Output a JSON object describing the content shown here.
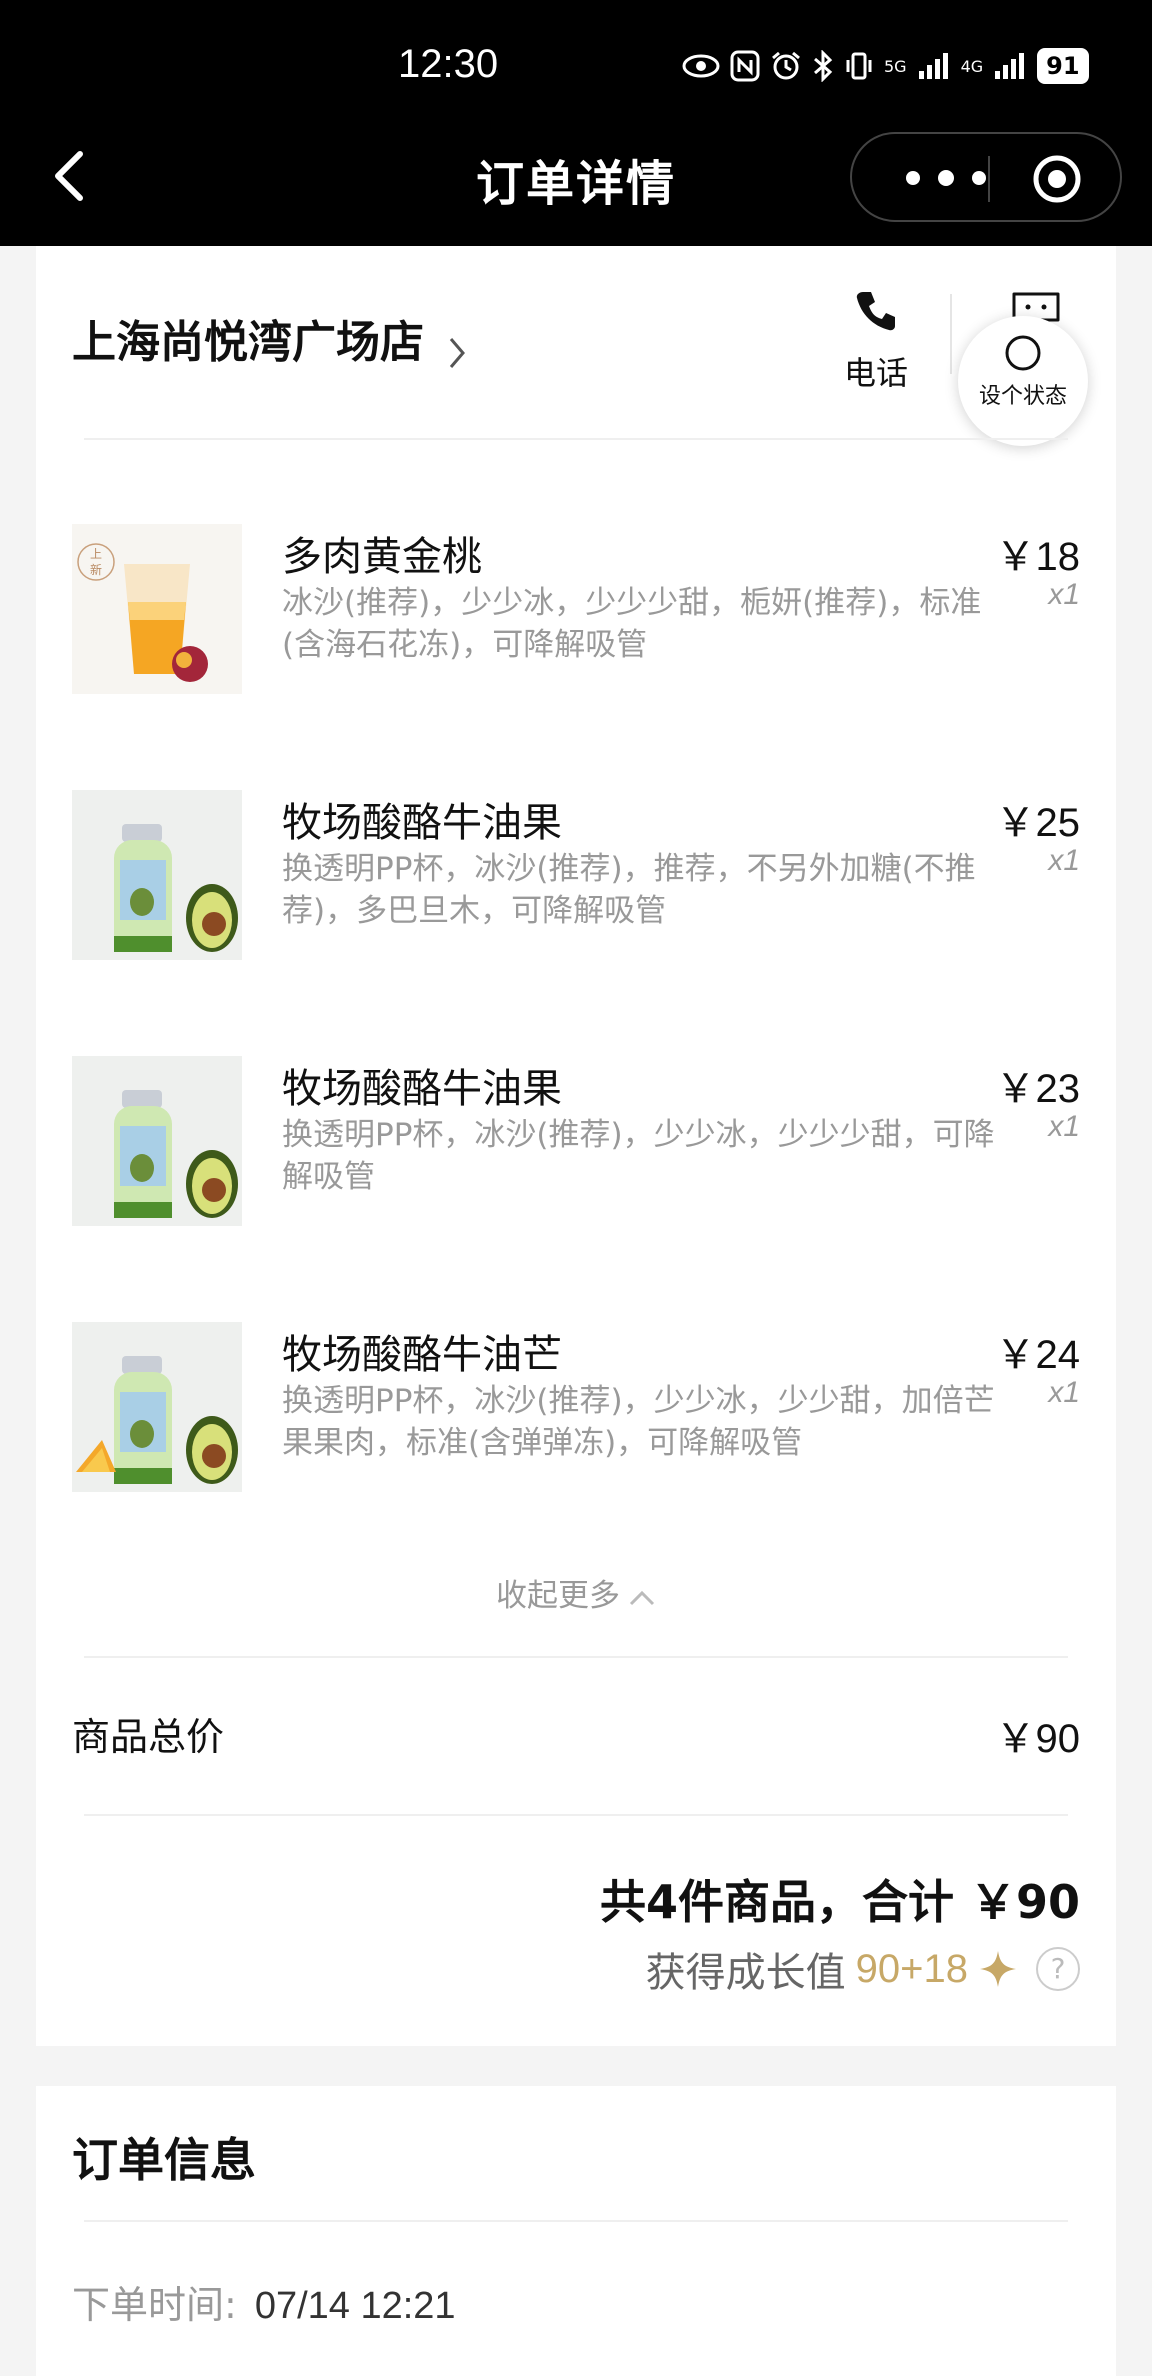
{
  "status_bar": {
    "time": "12:30",
    "network_5g": "5G",
    "network_4g": "4G",
    "battery": "91"
  },
  "nav": {
    "title": "订单详情",
    "back_icon": "chevron-left-icon",
    "more_icon": "more-dots-icon",
    "close_icon": "target-circle-icon"
  },
  "store": {
    "name": "上海尚悦湾广场店",
    "phone_label": "电话",
    "float_status_label": "设个状态"
  },
  "items": [
    {
      "name": "多肉黄金桃",
      "desc": "冰沙(推荐)，少少冰，少少少甜，栀妍(推荐)，标准(含海石花冻)，可降解吸管",
      "price": "￥18",
      "qty": "x1",
      "badge_top": "上",
      "badge_bottom": "新",
      "thumb": "peach-drink"
    },
    {
      "name": "牧场酸酪牛油果",
      "desc": "换透明PP杯，冰沙(推荐)，推荐，不另外加糖(不推荐)，多巴旦木，可降解吸管",
      "price": "￥25",
      "qty": "x1",
      "thumb": "avocado-bottle"
    },
    {
      "name": "牧场酸酪牛油果",
      "desc": "换透明PP杯，冰沙(推荐)，少少冰，少少少甜，可降解吸管",
      "price": "￥23",
      "qty": "x1",
      "thumb": "avocado-bottle"
    },
    {
      "name": "牧场酸酪牛油芒",
      "desc": "换透明PP杯，冰沙(推荐)，少少冰，少少甜，加倍芒果果肉，标准(含弹弹冻)，可降解吸管",
      "price": "￥24",
      "qty": "x1",
      "thumb": "avocado-mango-bottle"
    }
  ],
  "collapse_label": "收起更多",
  "total": {
    "label": "商品总价",
    "value": "￥90"
  },
  "summary": {
    "text": "共4件商品，合计 ￥90",
    "growth_label": "获得成长值",
    "growth_value": "90+18"
  },
  "order_info": {
    "title": "订单信息",
    "time_label": "下单时间:",
    "time_value": "07/14 12:21"
  },
  "colors": {
    "accent_gold": "#c7a867",
    "topbar": "#000000",
    "muted_text": "#999999"
  }
}
